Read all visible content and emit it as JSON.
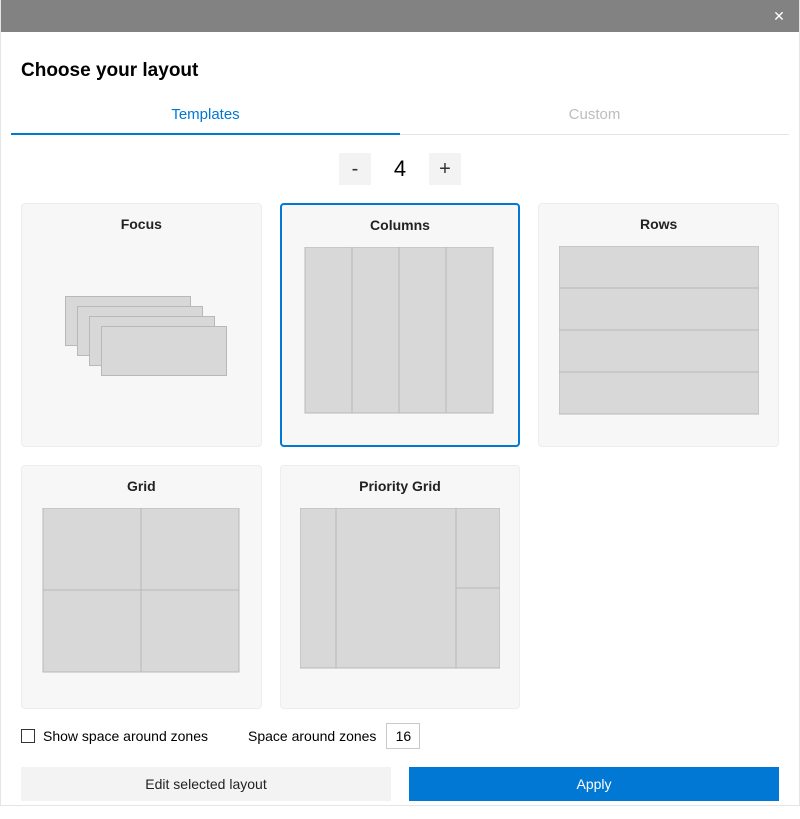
{
  "title": "Choose your layout",
  "tabs": {
    "templates": "Templates",
    "custom": "Custom"
  },
  "stepper": {
    "minus": "-",
    "value": "4",
    "plus": "+"
  },
  "templates": {
    "focus": "Focus",
    "columns": "Columns",
    "rows": "Rows",
    "grid": "Grid",
    "priority_grid": "Priority Grid"
  },
  "options": {
    "show_space_label": "Show space around zones",
    "space_label": "Space around zones",
    "space_value": "16"
  },
  "buttons": {
    "edit": "Edit selected layout",
    "apply": "Apply"
  }
}
